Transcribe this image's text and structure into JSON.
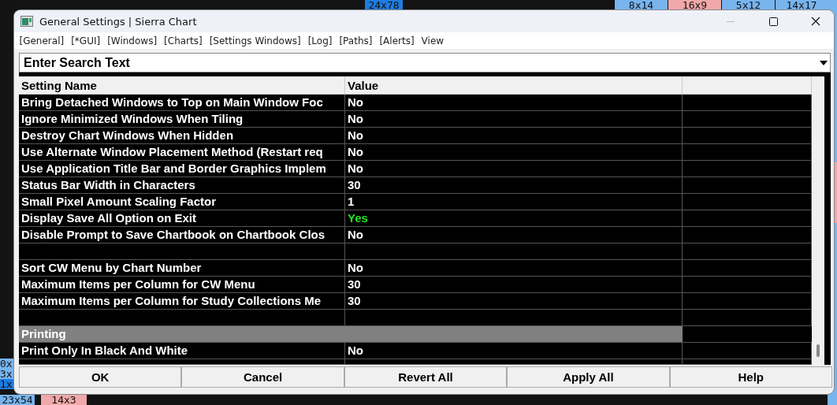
{
  "background_tiles": [
    {
      "label": "24x78",
      "color": "#1e7be0"
    },
    {
      "label": "8x14",
      "color": "#78b4ee"
    },
    {
      "label": "16x9",
      "color": "#f0a8a8"
    },
    {
      "label": "5x12",
      "color": "#78b4ee"
    },
    {
      "label": "14x17",
      "color": "#78b4ee"
    },
    {
      "label": "0x",
      "color": "#78b4ee"
    },
    {
      "label": "3x",
      "color": "#78b4ee"
    },
    {
      "label": "1x",
      "color": "#1e7be0"
    },
    {
      "label": "23x54",
      "color": "#78b4ee"
    },
    {
      "label": "14x3",
      "color": "#f0a8a8"
    }
  ],
  "window": {
    "title": "General Settings | Sierra Chart"
  },
  "menu": [
    "[General]",
    "[*GUI]",
    "[Windows]",
    "[Charts]",
    "[Settings Windows]",
    "[Log]",
    "[Paths]",
    "[Alerts]",
    "View"
  ],
  "search": {
    "placeholder": "Enter Search Text"
  },
  "table": {
    "columns": [
      "Setting Name",
      "Value"
    ],
    "rows": [
      {
        "kind": "setting",
        "name": "Bring Detached Windows to Top on Main Window Foc",
        "value": "No",
        "changed": false
      },
      {
        "kind": "setting",
        "name": "Ignore Minimized Windows When Tiling",
        "value": "No",
        "changed": false
      },
      {
        "kind": "setting",
        "name": "Destroy Chart Windows When Hidden",
        "value": "No",
        "changed": false
      },
      {
        "kind": "setting",
        "name": "Use Alternate Window Placement Method (Restart req",
        "value": "No",
        "changed": false
      },
      {
        "kind": "setting",
        "name": "Use Application Title Bar and Border Graphics Implem",
        "value": "No",
        "changed": false
      },
      {
        "kind": "setting",
        "name": "Status Bar Width in Characters",
        "value": "30",
        "changed": false
      },
      {
        "kind": "setting",
        "name": "Small Pixel Amount Scaling Factor",
        "value": "1",
        "changed": false
      },
      {
        "kind": "setting",
        "name": "Display Save All Option on Exit",
        "value": "Yes",
        "changed": true
      },
      {
        "kind": "setting",
        "name": "Disable Prompt to Save Chartbook on Chartbook Clos",
        "value": "No",
        "changed": false
      },
      {
        "kind": "blank"
      },
      {
        "kind": "setting",
        "name": "Sort CW Menu by Chart Number",
        "value": "No",
        "changed": false
      },
      {
        "kind": "setting",
        "name": "Maximum Items per Column for CW Menu",
        "value": "30",
        "changed": false
      },
      {
        "kind": "setting",
        "name": "Maximum Items per Column for Study Collections Me",
        "value": "30",
        "changed": false
      },
      {
        "kind": "blank"
      },
      {
        "kind": "section",
        "name": "Printing"
      },
      {
        "kind": "setting",
        "name": "Print Only In Black And White",
        "value": "No",
        "changed": false
      }
    ]
  },
  "buttons": [
    "OK",
    "Cancel",
    "Revert All",
    "Apply All",
    "Help"
  ]
}
